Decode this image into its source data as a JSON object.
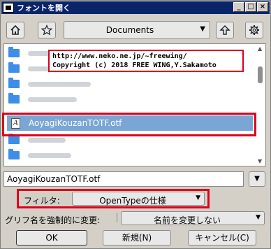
{
  "window": {
    "title": "フォントを開く",
    "controls": [
      "_",
      "□",
      "×"
    ]
  },
  "toolbar": {
    "home_icon": "home-icon",
    "favorite_icon": "star-icon",
    "directory": "Documents",
    "up_icon": "up-arrow-icon",
    "settings_icon": "gear-icon"
  },
  "file_list": {
    "selected_file": "AoyagiKouzanTOTF.otf",
    "selected_icon_glyph": "A"
  },
  "annotation": {
    "line1": "http://www.neko.ne.jp/~freewing/",
    "line2": "Copyright (c) 2018 FREE WING,Y.Sakamoto"
  },
  "filename_field": {
    "value": "AoyagiKouzanTOTF.otf"
  },
  "filter": {
    "label": "フィルタ:",
    "value": "OpenTypeの仕様"
  },
  "glyph_rename": {
    "label": "グリフ名を強制的に変更:",
    "value": "名前を変更しない"
  },
  "buttons": {
    "ok": "OK",
    "new": "新規(N)",
    "cancel": "キャンセル(C)"
  },
  "colors": {
    "highlight_box": "#e0001a",
    "selection": "#7aa6d6",
    "folder": "#3d8ee6",
    "titlebar": "#0a246a"
  }
}
